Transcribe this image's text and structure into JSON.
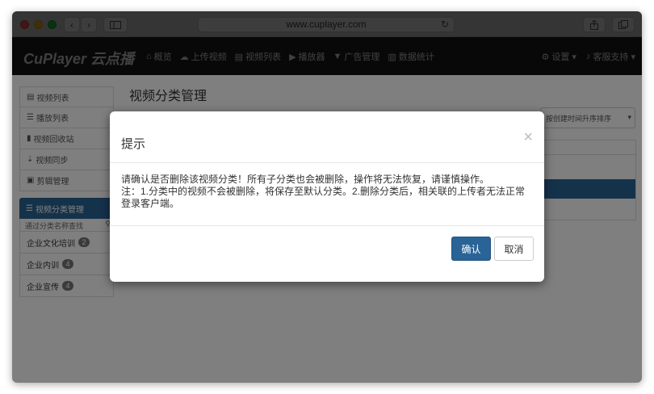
{
  "browser": {
    "url": "www.cuplayer.com",
    "back_glyph": "‹",
    "forward_glyph": "›",
    "reload_glyph": "↻"
  },
  "navbar": {
    "brand": "CuPlayer 云点播",
    "items": [
      {
        "icon": "home-icon",
        "glyph": "⌂",
        "label": "概览"
      },
      {
        "icon": "upload-icon",
        "glyph": "☁",
        "label": "上传视频"
      },
      {
        "icon": "film-icon",
        "glyph": "▤",
        "label": "视频列表"
      },
      {
        "icon": "play-icon",
        "glyph": "▶",
        "label": "播放器"
      },
      {
        "icon": "filter-icon",
        "glyph": "▼",
        "label": "广告管理"
      },
      {
        "icon": "stats-icon",
        "glyph": "▥",
        "label": "数据统计"
      }
    ],
    "right": [
      {
        "icon": "gear-icon",
        "glyph": "⚙",
        "label": "设置 ▾"
      },
      {
        "icon": "bell-icon",
        "glyph": "♪",
        "label": "客服支持 ▾"
      }
    ]
  },
  "sidebar": {
    "items": [
      {
        "glyph": "▤",
        "label": "视频列表"
      },
      {
        "glyph": "☰",
        "label": "播放列表"
      },
      {
        "glyph": "▮",
        "label": "视频回收站"
      },
      {
        "glyph": "⇣",
        "label": "视频同步"
      },
      {
        "glyph": "▣",
        "label": "剪辑管理"
      }
    ],
    "active": {
      "glyph": "☰",
      "label": "视频分类管理"
    },
    "search_placeholder": "通过分类名称查找",
    "search_glyph": "⚲",
    "categories": [
      {
        "label": "企业文化培训",
        "count": "2"
      },
      {
        "label": "企业内训",
        "count": "4"
      },
      {
        "label": "企业宣传",
        "count": "4"
      }
    ]
  },
  "main": {
    "title": "视频分类管理",
    "sort_label": "按创建时间升序排序",
    "sort_caret": "▾"
  },
  "modal": {
    "title": "提示",
    "close": "×",
    "body_line1": "请确认是否删除该视频分类！所有子分类也会被删除，操作将无法恢复，请谨慎操作。",
    "body_line2": "注：1.分类中的视频不会被删除，将保存至默认分类。2.删除分类后，相关联的上传者无法正常登录客户端。",
    "confirm": "确认",
    "cancel": "取消"
  },
  "colors": {
    "navbar_bg": "#222222",
    "primary": "#2a6496",
    "overlay": "rgba(0,0,0,0.5)"
  }
}
